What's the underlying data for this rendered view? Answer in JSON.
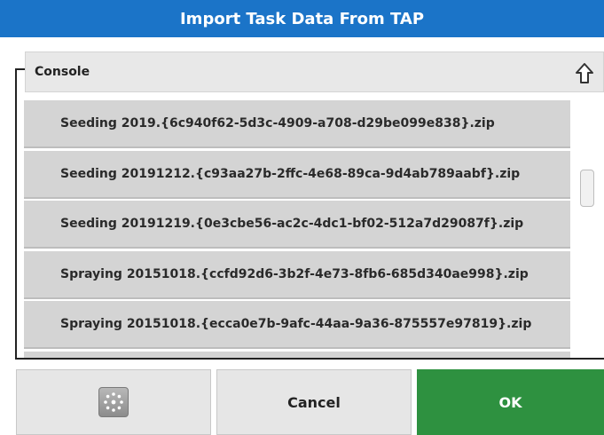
{
  "dialog": {
    "title": "Import Task Data From TAP"
  },
  "location": {
    "label": "Console",
    "up_icon": "folder-up-icon"
  },
  "files": [
    {
      "name": "Seeding 2019.{6c940f62-5d3c-4909-a708-d29be099e838}.zip"
    },
    {
      "name": "Seeding 20191212.{c93aa27b-2ffc-4e68-89ca-9d4ab789aabf}.zip"
    },
    {
      "name": "Seeding 20191219.{0e3cbe56-ac2c-4dc1-bf02-512a7d29087f}.zip"
    },
    {
      "name": "Spraying 20151018.{ccfd92d6-3b2f-4e73-8fb6-685d340ae998}.zip"
    },
    {
      "name": "Spraying 20151018.{ecca0e7b-9afc-44aa-9a36-875557e97819}.zip"
    }
  ],
  "footer": {
    "settings_icon": "settings-icon",
    "cancel_label": "Cancel",
    "ok_label": "OK"
  },
  "colors": {
    "title_bar": "#1b74c8",
    "ok_button": "#2e9140",
    "row_background": "#d4d4d4"
  }
}
